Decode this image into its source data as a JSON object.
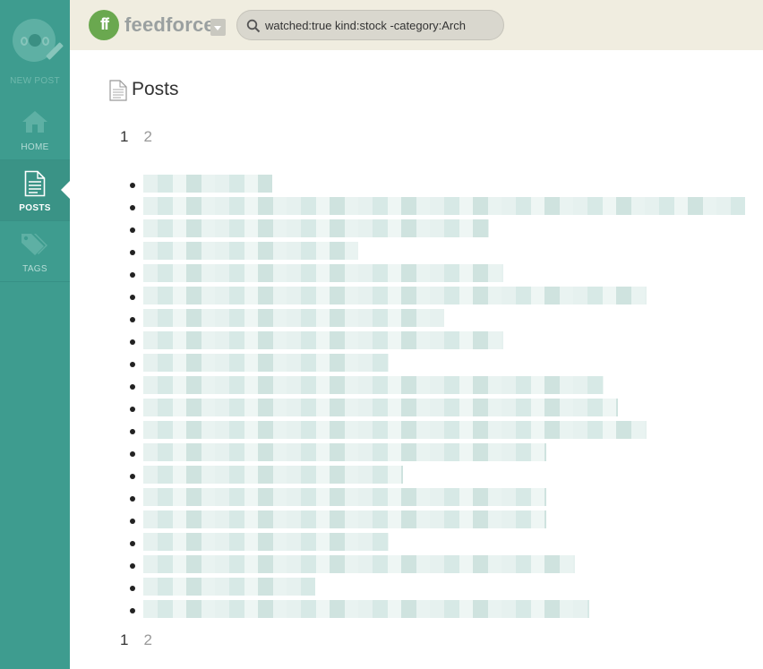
{
  "sidebar": {
    "new_post_label": "NEW POST",
    "items": [
      {
        "label": "HOME",
        "icon": "home-icon"
      },
      {
        "label": "POSTS",
        "icon": "document-icon",
        "active": true
      },
      {
        "label": "TAGS",
        "icon": "tags-icon"
      }
    ]
  },
  "header": {
    "logo_text": "ff",
    "brand": "feedforce",
    "search_value": "watched:true kind:stock -category:Arch"
  },
  "main": {
    "title": "Posts",
    "pager": [
      "1",
      "2"
    ],
    "current_page": "1",
    "posts_count": 20
  },
  "colors": {
    "sidebar": "#3e9c8f",
    "topbar": "#f0ede0",
    "logo": "#6aa84f"
  }
}
